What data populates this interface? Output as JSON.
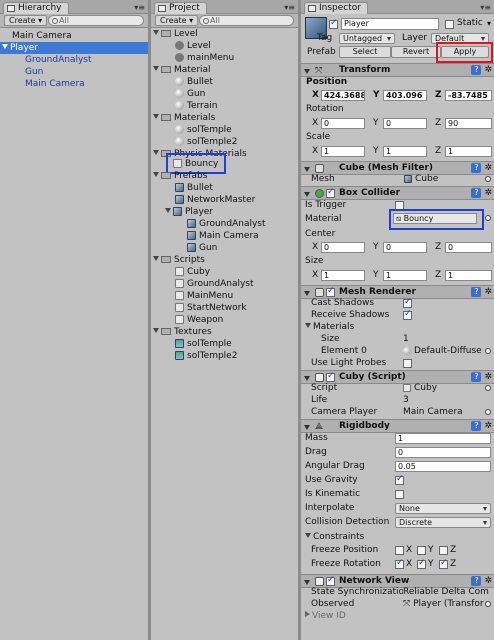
{
  "hierarchy": {
    "tab": "Hierarchy",
    "create": "Create",
    "search_placeholder": "All",
    "items": [
      "Main Camera",
      "Player",
      "GroundAnalyst",
      "Gun",
      "Main Camera"
    ]
  },
  "project": {
    "tab": "Project",
    "create": "Create",
    "search_placeholder": "All",
    "folders": {
      "level": "Level",
      "level_items": [
        "Level",
        "mainMenu"
      ],
      "material": "Material",
      "material_items": [
        "Bullet",
        "Gun",
        "Terrain"
      ],
      "materials": "Materials",
      "materials_items": [
        "solTemple",
        "solTemple2"
      ],
      "physic": "Physic Materials",
      "physic_items": [
        "Bouncy"
      ],
      "prefabs": "Prefabs",
      "prefabs_items": [
        "Bullet",
        "NetworkMaster",
        "Player"
      ],
      "player_children": [
        "GroundAnalyst",
        "Main Camera",
        "Gun"
      ],
      "scripts": "Scripts",
      "scripts_items": [
        "Cuby",
        "GroundAnalyst",
        "MainMenu",
        "StartNetwork",
        "Weapon"
      ],
      "textures": "Textures",
      "textures_items": [
        "solTemple",
        "solTemple2"
      ]
    }
  },
  "inspector": {
    "tab": "Inspector",
    "name": "Player",
    "static": "Static",
    "tag_label": "Tag",
    "tag_value": "Untagged",
    "layer_label": "Layer",
    "layer_value": "Default",
    "prefab_label": "Prefab",
    "select": "Select",
    "revert": "Revert",
    "apply": "Apply",
    "transform": {
      "title": "Transform",
      "position": "Position",
      "pos": [
        "424.3688",
        "403.096",
        "-83.7485"
      ],
      "rotation": "Rotation",
      "rot": [
        "0",
        "0",
        "90"
      ],
      "scale": "Scale",
      "scl": [
        "1",
        "1",
        "1"
      ]
    },
    "meshfilter": {
      "title": "Cube (Mesh Filter)",
      "mesh_label": "Mesh",
      "mesh_value": "Cube"
    },
    "boxcollider": {
      "title": "Box Collider",
      "is_trigger": "Is Trigger",
      "material_label": "Material",
      "material_value": "Bouncy",
      "center": "Center",
      "ctr": [
        "0",
        "0",
        "0"
      ],
      "size": "Size",
      "sz": [
        "1",
        "1",
        "1"
      ]
    },
    "meshrenderer": {
      "title": "Mesh Renderer",
      "cast": "Cast Shadows",
      "receive": "Receive Shadows",
      "materials": "Materials",
      "size": "Size",
      "size_value": "1",
      "element": "Element 0",
      "element_value": "Default-Diffuse",
      "lightprobes": "Use Light Probes"
    },
    "cuby": {
      "title": "Cuby (Script)",
      "script_label": "Script",
      "script_value": "Cuby",
      "life_label": "Life",
      "life_value": "3",
      "camera_label": "Camera Player",
      "camera_value": "Main Camera"
    },
    "rigidbody": {
      "title": "Rigidbody",
      "mass": "Mass",
      "mass_value": "1",
      "drag": "Drag",
      "drag_value": "0",
      "angular": "Angular Drag",
      "angular_value": "0.05",
      "gravity": "Use Gravity",
      "kinematic": "Is Kinematic",
      "interpolate": "Interpolate",
      "interpolate_value": "None",
      "collision": "Collision Detection",
      "collision_value": "Discrete",
      "constraints": "Constraints",
      "freeze_pos": "Freeze Position",
      "freeze_rot": "Freeze Rotation",
      "x": "X",
      "y": "Y",
      "z": "Z"
    },
    "networkview": {
      "title": "Network View",
      "sync_label": "State Synchronizatio",
      "sync_value": "Reliable Delta Com",
      "observed_label": "Observed",
      "observed_value": "Player (Transfor",
      "viewid": "View ID"
    },
    "axis": {
      "x": "X",
      "y": "Y",
      "z": "Z"
    }
  },
  "colors": {
    "selection": "#3d7ad6",
    "highlight_blue": "#1f3fd0",
    "highlight_red": "#e0141e"
  }
}
